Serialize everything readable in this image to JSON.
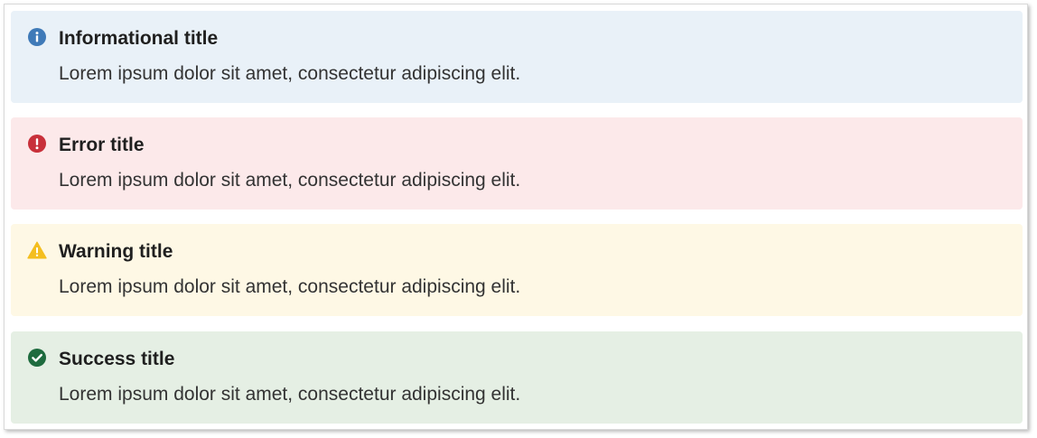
{
  "alerts": [
    {
      "kind": "info",
      "icon": "info-circle-icon",
      "title": "Informational title",
      "message": "Lorem ipsum dolor sit amet, consectetur adipiscing elit.",
      "background": "#e9f1f8",
      "icon_color": "#3f7ab8"
    },
    {
      "kind": "error",
      "icon": "exclamation-circle-icon",
      "title": "Error title",
      "message": "Lorem ipsum dolor sit amet, consectetur adipiscing elit.",
      "background": "#fce9ea",
      "icon_color": "#c8303a"
    },
    {
      "kind": "warning",
      "icon": "warning-triangle-icon",
      "title": "Warning title",
      "message": "Lorem ipsum dolor sit amet, consectetur adipiscing elit.",
      "background": "#fef8e5",
      "icon_color": "#f4be1f"
    },
    {
      "kind": "success",
      "icon": "check-circle-icon",
      "title": "Success title",
      "message": "Lorem ipsum dolor sit amet, consectetur adipiscing elit.",
      "background": "#e5efe4",
      "icon_color": "#1e6b3e"
    }
  ]
}
